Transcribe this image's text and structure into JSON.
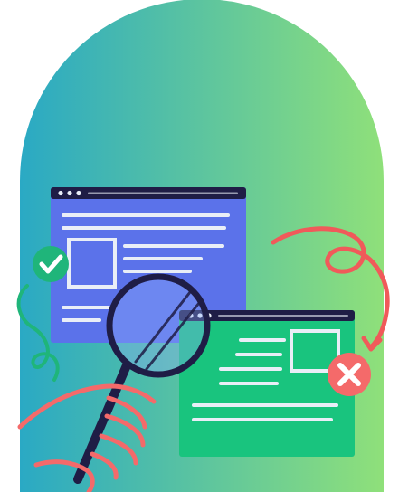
{
  "illustration": {
    "subject": "magnifying-glass-comparing-two-browser-windows",
    "colors": {
      "arch_gradient_start": "#2aa9c4",
      "arch_gradient_end": "#8fe07a",
      "window_blue": "#5b72ea",
      "window_green": "#19c47e",
      "window_bar": "#1f1d46",
      "lines": "#e9eef7",
      "check_badge": "#1fb57a",
      "cross_badge": "#f46a6a",
      "squiggle_red": "#f05a5a",
      "squiggle_green": "#1fb57a",
      "hand": "#f46a6a",
      "lens_tint": "#8fb0ff"
    },
    "icons": [
      "check-icon",
      "close-icon",
      "magnifier-icon",
      "hand-icon"
    ]
  }
}
